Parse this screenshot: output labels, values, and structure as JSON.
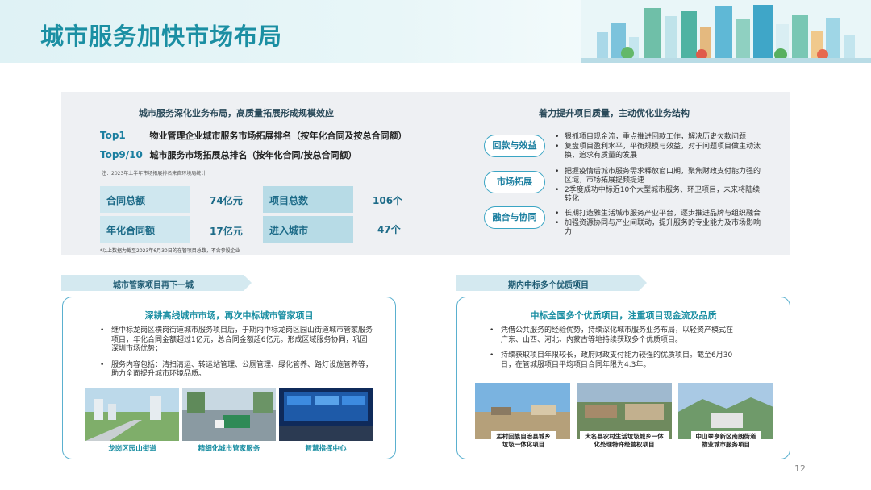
{
  "page": {
    "title": "城市服务加快市场布局",
    "page_number": "12"
  },
  "top_left": {
    "heading": "城市服务深化业务布局，高质量拓展形成规模效应",
    "ranks": [
      {
        "tag": "Top1",
        "text": "物业管理企业城市服务市场拓展排名（按年化合同及按总合同额）"
      },
      {
        "tag": "Top9/10",
        "text": "城市服务市场拓展总排名（按年化合同/按总合同额）"
      }
    ],
    "note": "注：2023年上半年市场拓展排名来自环境局统计",
    "stats": [
      {
        "label": "合同总额",
        "value": "74亿元"
      },
      {
        "label": "项目总数",
        "value": "106个"
      },
      {
        "label": "年化合同额",
        "value": "17亿元"
      },
      {
        "label": "进入城市",
        "value": "47个"
      }
    ],
    "footnote": "*以上数据为截至2023年6月30日的在管项目总数，不含参股企业"
  },
  "top_right": {
    "heading": "着力提升项目质量，主动优化业务结构",
    "items": [
      {
        "pill": "回款与效益",
        "bullets": [
          "狠抓项目现金流，重点推进回款工作，解决历史欠款问题",
          "复盘项目盈利水平，平衡规模与效益，对于问题项目做主动汰换，追求有质量的发展"
        ]
      },
      {
        "pill": "市场拓展",
        "bullets": [
          "把握疫情后城市服务需求释放窗口期，聚焦财政支付能力强的区域，市场拓展提频提速",
          "2季度成功中标近10个大型城市服务、环卫项目，未来将陆续转化"
        ]
      },
      {
        "pill": "融合与协同",
        "bullets": [
          "长期打造雅生活城市服务产业平台，逐步推进品牌与组织融合",
          "加强资源协同与产业间联动，提升服务的专业能力及市场影响力"
        ]
      }
    ]
  },
  "bottom_left": {
    "section_label": "城市管家项目再下一城",
    "card_title": "深耕高线城市市场，再次中标城市管家项目",
    "bullets": [
      "继中标龙岗区横岗街道城市服务项目后，于期内中标龙岗区园山街道城市管家服务项目，年化合同金额超过1亿元，总合同金额超6亿元。形成区域服务协同，巩固深圳市场优势；",
      "服务内容包括：清扫清运、转运站管理、公厕管理、绿化管养、路灯设施管养等，助力全面提升城市环境品质。"
    ],
    "photos": [
      {
        "caption": "龙岗区园山街道"
      },
      {
        "caption": "精细化城市管家服务"
      },
      {
        "caption": "智慧指挥中心"
      }
    ]
  },
  "bottom_right": {
    "section_label": "期内中标多个优质项目",
    "card_title": "中标全国多个优质项目，注重项目现金流及品质",
    "bullets": [
      "凭借公共服务的经验优势，持续深化城市服务业务布局，以轻资产模式在广东、山西、河北、内蒙古等地持续获取多个优质项目。",
      "持续获取项目年限较长，政府财政支付能力较强的优质项目。截至6月30日，在管城服项目平均项目合同年限为4.3年。"
    ],
    "photos": [
      {
        "caption": "孟村回族自治县城乡垃圾一体化项目"
      },
      {
        "caption": "大名县农村生活垃圾城乡一体化处理特许经营权项目"
      },
      {
        "caption": "中山翠亨新区南朗街道物业城市服务项目"
      }
    ]
  },
  "colors": {
    "accent": "#1b8fa3",
    "panel_grey": "#eef0f3",
    "stat_fill": "#cfe7ef",
    "card_border": "#5ab0cf"
  }
}
